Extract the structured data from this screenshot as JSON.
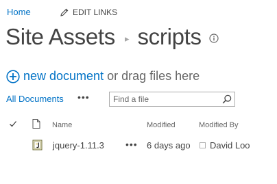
{
  "topbar": {
    "home_label": "Home",
    "edit_links_label": "EDIT LINKS"
  },
  "title": {
    "site": "Site Assets",
    "separator": "▸",
    "library": "scripts"
  },
  "commands": {
    "new_document_label": "new document",
    "drag_hint": "or drag files here"
  },
  "views": {
    "all_documents_label": "All Documents",
    "more_label": "•••",
    "search_placeholder": "Find a file"
  },
  "list": {
    "columns": {
      "name": "Name",
      "modified": "Modified",
      "modified_by": "Modified By"
    },
    "rows": [
      {
        "name": "jquery-1.11.3",
        "menu": "•••",
        "modified": "6 days ago",
        "modified_by": "David Loo",
        "icon": "js-file-icon"
      }
    ]
  },
  "colors": {
    "accent": "#0072c6",
    "text": "#444444",
    "muted": "#666666"
  }
}
